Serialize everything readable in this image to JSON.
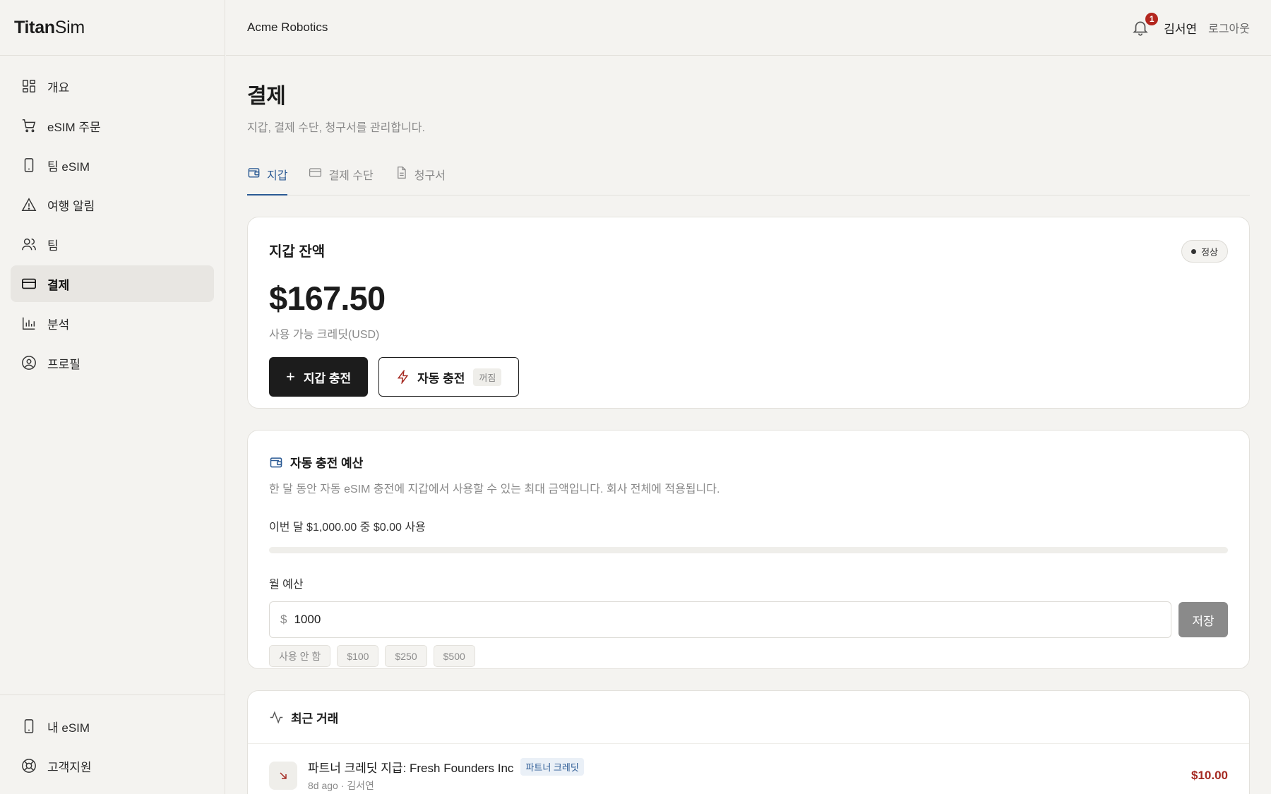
{
  "brand": {
    "bold": "Titan",
    "light": "Sim"
  },
  "sidebar": {
    "items": [
      {
        "label": "개요",
        "icon": "grid-icon"
      },
      {
        "label": "eSIM 주문",
        "icon": "cart-icon"
      },
      {
        "label": "팀 eSIM",
        "icon": "phone-icon"
      },
      {
        "label": "여행 알림",
        "icon": "alert-triangle-icon"
      },
      {
        "label": "팀",
        "icon": "users-icon"
      },
      {
        "label": "결제",
        "icon": "credit-card-icon",
        "active": true
      },
      {
        "label": "분석",
        "icon": "bar-chart-icon"
      },
      {
        "label": "프로필",
        "icon": "user-circle-icon"
      }
    ],
    "bottom": [
      {
        "label": "내 eSIM",
        "icon": "phone-icon"
      },
      {
        "label": "고객지원",
        "icon": "lifebuoy-icon"
      }
    ]
  },
  "header": {
    "org": "Acme Robotics",
    "notifications": "1",
    "user": "김서연",
    "logout": "로그아웃"
  },
  "page": {
    "title": "결제",
    "subtitle": "지갑, 결제 수단, 청구서를 관리합니다.",
    "tabs": [
      {
        "label": "지갑",
        "icon": "wallet-icon",
        "active": true
      },
      {
        "label": "결제 수단",
        "icon": "credit-card-icon"
      },
      {
        "label": "청구서",
        "icon": "document-icon"
      }
    ]
  },
  "wallet": {
    "title": "지갑 잔액",
    "status": "정상",
    "balance": "$167.50",
    "balance_sub": "사용 가능 크레딧(USD)",
    "topup_label": "지갑 충전",
    "autotopup_label": "자동 충전",
    "autotopup_state": "꺼짐"
  },
  "budget": {
    "title": "자동 충전 예산",
    "description": "한 달 동안 자동 eSIM 충전에 지갑에서 사용할 수 있는 최대 금액입니다. 회사 전체에 적용됩니다.",
    "usage_text": "이번 달 $1,000.00 중 $0.00 사용",
    "usage_fraction": 0,
    "monthly_label": "월 예산",
    "currency": "$",
    "value": "1000",
    "save_label": "저장",
    "presets": [
      "사용 안 함",
      "$100",
      "$250",
      "$500"
    ]
  },
  "transactions": {
    "title": "최근 거래",
    "items": [
      {
        "title": "파트너 크레딧 지급: Fresh Founders Inc",
        "tag": "파트너 크레딧",
        "meta": "8d ago · 김서연",
        "amount": "$10.00"
      }
    ]
  },
  "colors": {
    "accent": "#2b5a94",
    "danger": "#a52a22",
    "badge": "#b3261e"
  }
}
